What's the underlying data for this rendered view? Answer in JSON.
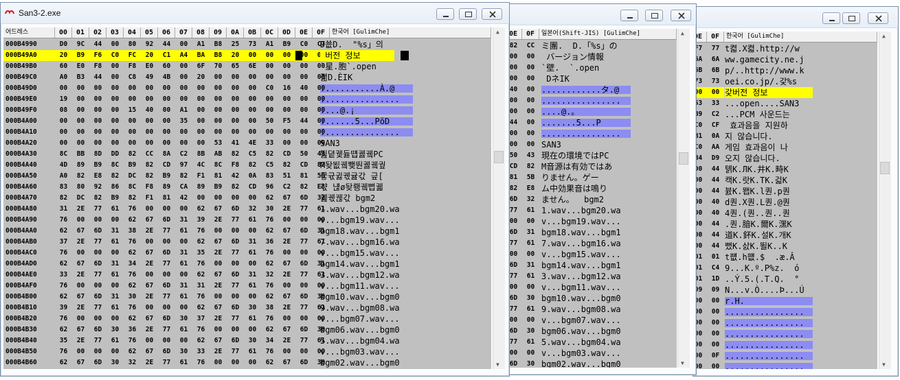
{
  "colors": {
    "highlight": "#ffff00",
    "block": "#8c8cf2",
    "pane": "#c0c0c0"
  },
  "win1": {
    "title": "San3-2.exe",
    "header_address": "어드레스",
    "header_text": "한국어 [GulimChe]",
    "columns": [
      "00",
      "01",
      "02",
      "03",
      "04",
      "05",
      "06",
      "07",
      "08",
      "09",
      "0A",
      "0B",
      "0C",
      "0D",
      "0E",
      "0F"
    ],
    "rows": [
      {
        "addr": "000B4990",
        "bytes": [
          "D0",
          "9C",
          "44",
          "00",
          "80",
          "92",
          "44",
          "00",
          "A1",
          "B8",
          "25",
          "73",
          "A1",
          "B9",
          "C0",
          "C7"
        ],
        "text": "Ð쑚D.  \"%s」의"
      },
      {
        "addr": "000B49A0",
        "bytes": [
          "20",
          "B9",
          "F6",
          "C0",
          "FC",
          "20",
          "C1",
          "A4",
          "BA",
          "B8",
          "20",
          "00",
          "00",
          "00",
          "00",
          "00"
        ],
        "text": " 버전 정보"
      },
      {
        "addr": "000B49B0",
        "bytes": [
          "60",
          "E0",
          "F8",
          "00",
          "F8",
          "E0",
          "60",
          "00",
          "6F",
          "70",
          "65",
          "6E",
          "00",
          "00",
          "00",
          "00"
        ],
        "text": "`星.胞`.open"
      },
      {
        "addr": "000B49C0",
        "bytes": [
          "A0",
          "B3",
          "44",
          "00",
          "C8",
          "49",
          "4B",
          "00",
          "20",
          "00",
          "00",
          "00",
          "00",
          "00",
          "00",
          "00"
        ],
        "text": "졂D.ÈIK"
      },
      {
        "addr": "000B49D0",
        "bytes": [
          "00",
          "00",
          "00",
          "00",
          "00",
          "00",
          "00",
          "00",
          "00",
          "00",
          "00",
          "00",
          "C0",
          "16",
          "40",
          "00"
        ],
        "text": "............À.@"
      },
      {
        "addr": "000B49E0",
        "bytes": [
          "19",
          "00",
          "00",
          "00",
          "00",
          "00",
          "00",
          "00",
          "00",
          "00",
          "00",
          "00",
          "00",
          "00",
          "00",
          "00"
        ],
        "text": "................"
      },
      {
        "addr": "000B49F0",
        "bytes": [
          "08",
          "00",
          "00",
          "00",
          "15",
          "40",
          "00",
          "A1",
          "00",
          "00",
          "00",
          "00",
          "00",
          "00",
          "00",
          "00"
        ],
        "text": "....@.¡"
      },
      {
        "addr": "000B4A00",
        "bytes": [
          "00",
          "00",
          "00",
          "00",
          "00",
          "00",
          "00",
          "35",
          "00",
          "00",
          "00",
          "00",
          "50",
          "F5",
          "44",
          "00"
        ],
        "text": ".......5...PõD"
      },
      {
        "addr": "000B4A10",
        "bytes": [
          "00",
          "00",
          "00",
          "00",
          "00",
          "00",
          "00",
          "00",
          "00",
          "00",
          "00",
          "00",
          "00",
          "00",
          "00",
          "00"
        ],
        "text": "................"
      },
      {
        "addr": "000B4A20",
        "bytes": [
          "00",
          "00",
          "00",
          "00",
          "00",
          "00",
          "00",
          "00",
          "00",
          "53",
          "41",
          "4E",
          "33",
          "00",
          "00",
          "00"
        ],
        "text": "SAN3"
      },
      {
        "addr": "000B4A30",
        "bytes": [
          "8C",
          "BB",
          "8D",
          "DD",
          "82",
          "CC",
          "8A",
          "C2",
          "8B",
          "AB",
          "82",
          "C5",
          "82",
          "CD",
          "50",
          "43"
        ],
        "text": "뙲뎥궻듏떕궳궼PC"
      },
      {
        "addr": "000B4A40",
        "bytes": [
          "4D",
          "89",
          "B9",
          "8C",
          "B9",
          "82",
          "CD",
          "97",
          "4C",
          "8C",
          "F8",
          "82",
          "C5",
          "82",
          "CD",
          "82"
        ],
        "text": "M돶뙶궼뾎뚼궳궼궢"
      },
      {
        "addr": "000B4A50",
        "bytes": [
          "A0",
          "82",
          "E8",
          "82",
          "DC",
          "82",
          "B9",
          "82",
          "F1",
          "81",
          "42",
          "0A",
          "83",
          "51",
          "81",
          "5B"
        ],
        "text": "궇귟귏궧귪갃 긒["
      },
      {
        "addr": "000B4A60",
        "bytes": [
          "83",
          "80",
          "92",
          "86",
          "8C",
          "F8",
          "89",
          "CA",
          "89",
          "B9",
          "82",
          "CD",
          "96",
          "C2",
          "82",
          "E8"
        ],
        "text": "갻 냲ø돶뢩궼뻡궯"
      },
      {
        "addr": "000B4A70",
        "bytes": [
          "82",
          "DC",
          "82",
          "B9",
          "82",
          "F1",
          "81",
          "42",
          "00",
          "00",
          "00",
          "00",
          "62",
          "67",
          "6D",
          "32"
        ],
        "text": "궲궧궪갃 bgm2"
      },
      {
        "addr": "000B4A80",
        "bytes": [
          "31",
          "2E",
          "77",
          "61",
          "76",
          "00",
          "00",
          "00",
          "62",
          "67",
          "6D",
          "32",
          "30",
          "2E",
          "77",
          "61"
        ],
        "text": "1.wav...bgm20.wa"
      },
      {
        "addr": "000B4A90",
        "bytes": [
          "76",
          "00",
          "00",
          "00",
          "62",
          "67",
          "6D",
          "31",
          "39",
          "2E",
          "77",
          "61",
          "76",
          "00",
          "00",
          "00"
        ],
        "text": "v...bgm19.wav..."
      },
      {
        "addr": "000B4AA0",
        "bytes": [
          "62",
          "67",
          "6D",
          "31",
          "38",
          "2E",
          "77",
          "61",
          "76",
          "00",
          "00",
          "00",
          "62",
          "67",
          "6D",
          "31"
        ],
        "text": "bgm18.wav...bgm1"
      },
      {
        "addr": "000B4AB0",
        "bytes": [
          "37",
          "2E",
          "77",
          "61",
          "76",
          "00",
          "00",
          "00",
          "62",
          "67",
          "6D",
          "31",
          "36",
          "2E",
          "77",
          "61"
        ],
        "text": "7.wav...bgm16.wa"
      },
      {
        "addr": "000B4AC0",
        "bytes": [
          "76",
          "00",
          "00",
          "00",
          "62",
          "67",
          "6D",
          "31",
          "35",
          "2E",
          "77",
          "61",
          "76",
          "00",
          "00",
          "00"
        ],
        "text": "v...bgm15.wav..."
      },
      {
        "addr": "000B4AD0",
        "bytes": [
          "62",
          "67",
          "6D",
          "31",
          "34",
          "2E",
          "77",
          "61",
          "76",
          "00",
          "00",
          "00",
          "62",
          "67",
          "6D",
          "31"
        ],
        "text": "bgm14.wav...bgm1"
      },
      {
        "addr": "000B4AE0",
        "bytes": [
          "33",
          "2E",
          "77",
          "61",
          "76",
          "00",
          "00",
          "00",
          "62",
          "67",
          "6D",
          "31",
          "32",
          "2E",
          "77",
          "61"
        ],
        "text": "3.wav...bgm12.wa"
      },
      {
        "addr": "000B4AF0",
        "bytes": [
          "76",
          "00",
          "00",
          "00",
          "62",
          "67",
          "6D",
          "31",
          "31",
          "2E",
          "77",
          "61",
          "76",
          "00",
          "00",
          "00"
        ],
        "text": "v...bgm11.wav..."
      },
      {
        "addr": "000B4B00",
        "bytes": [
          "62",
          "67",
          "6D",
          "31",
          "30",
          "2E",
          "77",
          "61",
          "76",
          "00",
          "00",
          "00",
          "62",
          "67",
          "6D",
          "30"
        ],
        "text": "bgm10.wav...bgm0"
      },
      {
        "addr": "000B4B10",
        "bytes": [
          "39",
          "2E",
          "77",
          "61",
          "76",
          "00",
          "00",
          "00",
          "62",
          "67",
          "6D",
          "30",
          "38",
          "2E",
          "77",
          "61"
        ],
        "text": "9.wav...bgm08.wa"
      },
      {
        "addr": "000B4B20",
        "bytes": [
          "76",
          "00",
          "00",
          "00",
          "62",
          "67",
          "6D",
          "30",
          "37",
          "2E",
          "77",
          "61",
          "76",
          "00",
          "00",
          "00"
        ],
        "text": "v...bgm07.wav..."
      },
      {
        "addr": "000B4B30",
        "bytes": [
          "62",
          "67",
          "6D",
          "30",
          "36",
          "2E",
          "77",
          "61",
          "76",
          "00",
          "00",
          "00",
          "62",
          "67",
          "6D",
          "30"
        ],
        "text": "bgm06.wav...bgm0"
      },
      {
        "addr": "000B4B40",
        "bytes": [
          "35",
          "2E",
          "77",
          "61",
          "76",
          "00",
          "00",
          "00",
          "62",
          "67",
          "6D",
          "30",
          "34",
          "2E",
          "77",
          "61"
        ],
        "text": "5.wav...bgm04.wa"
      },
      {
        "addr": "000B4B50",
        "bytes": [
          "76",
          "00",
          "00",
          "00",
          "62",
          "67",
          "6D",
          "30",
          "33",
          "2E",
          "77",
          "61",
          "76",
          "00",
          "00",
          "00"
        ],
        "text": "v...bgm03.wav..."
      },
      {
        "addr": "000B4B60",
        "bytes": [
          "62",
          "67",
          "6D",
          "30",
          "32",
          "2E",
          "77",
          "61",
          "76",
          "00",
          "00",
          "00",
          "62",
          "67",
          "6D",
          "30"
        ],
        "text": "bgm02.wav...bgm0"
      }
    ]
  },
  "win2": {
    "header_cols": [
      "0E",
      "0F"
    ],
    "header_text": "일본어(Shift-JIS) [GulimChe]",
    "rows": [
      {
        "b": [
          "82",
          "CC"
        ],
        "text": "ミ團.  D.「%s」の"
      },
      {
        "b": [
          "00",
          "00"
        ],
        "text": " バージョン情報"
      },
      {
        "b": [
          "00",
          "00"
        ],
        "text": "`壁.  `.open"
      },
      {
        "b": [
          "00",
          "00"
        ],
        "text": " DネIK"
      },
      {
        "b": [
          "40",
          "00"
        ],
        "text": "............タ.@"
      },
      {
        "b": [
          "00",
          "00"
        ],
        "text": "................"
      },
      {
        "b": [
          "00",
          "00"
        ],
        "text": "....@.｡"
      },
      {
        "b": [
          "44",
          "00"
        ],
        "text": ".......5...P"
      },
      {
        "b": [
          "00",
          "00"
        ],
        "text": "................"
      },
      {
        "b": [
          "00",
          "00"
        ],
        "text": "SAN3"
      },
      {
        "b": [
          "50",
          "43"
        ],
        "text": "現在の環境ではPC"
      },
      {
        "b": [
          "CD",
          "82"
        ],
        "text": "M音源は有効ではあ"
      },
      {
        "b": [
          "81",
          "5B"
        ],
        "text": "りません。ゲー"
      },
      {
        "b": [
          "82",
          "E8"
        ],
        "text": "ム中効果音は鳴り"
      },
      {
        "b": [
          "6D",
          "32"
        ],
        "text": "ません。  bgm2"
      },
      {
        "b": [
          "77",
          "61"
        ],
        "text": "1.wav...bgm20.wa"
      },
      {
        "b": [
          "00",
          "00"
        ],
        "text": "v...bgm19.wav..."
      },
      {
        "b": [
          "6D",
          "31"
        ],
        "text": "bgm18.wav...bgm1"
      },
      {
        "b": [
          "77",
          "61"
        ],
        "text": "7.wav...bgm16.wa"
      },
      {
        "b": [
          "00",
          "00"
        ],
        "text": "v...bgm15.wav..."
      },
      {
        "b": [
          "6D",
          "31"
        ],
        "text": "bgm14.wav...bgm1"
      },
      {
        "b": [
          "77",
          "61"
        ],
        "text": "3.wav...bgm12.wa"
      },
      {
        "b": [
          "00",
          "00"
        ],
        "text": "v...bgm11.wav..."
      },
      {
        "b": [
          "6D",
          "30"
        ],
        "text": "bgm10.wav...bgm0"
      },
      {
        "b": [
          "77",
          "61"
        ],
        "text": "9.wav...bgm08.wa"
      },
      {
        "b": [
          "00",
          "00"
        ],
        "text": "v...bgm07.wav..."
      },
      {
        "b": [
          "6D",
          "30"
        ],
        "text": "bgm06.wav...bgm0"
      },
      {
        "b": [
          "77",
          "61"
        ],
        "text": "5.wav...bgm04.wa"
      },
      {
        "b": [
          "00",
          "00"
        ],
        "text": "v...bgm03.wav..."
      },
      {
        "b": [
          "6D",
          "30"
        ],
        "text": "bgm02.wav...bgm0"
      }
    ]
  },
  "win3": {
    "header_cols": [
      "0E",
      "0F"
    ],
    "header_text": "한국어 [GulimChe]",
    "rows": [
      {
        "b": [
          "F7",
          "77"
        ],
        "text": "t켧.X켧.http://w"
      },
      {
        "b": [
          "6A",
          "6A"
        ],
        "text": "ww.gamecity.ne.j"
      },
      {
        "b": [
          "6B",
          "6B"
        ],
        "text": "p/..http://www.k"
      },
      {
        "b": [
          "73",
          "73"
        ],
        "text": "oei.co.jp/.갗%s"
      },
      {
        "b": [
          "00",
          "00"
        ],
        "text": "갗버전 정보"
      },
      {
        "b": [
          "53",
          "33"
        ],
        "text": "...open....SAN3"
      },
      {
        "b": [
          "B9",
          "C2"
        ],
        "text": "...PCM 사운드는"
      },
      {
        "b": [
          "C0",
          "CF"
        ],
        "text": " 효과음을 지원하"
      },
      {
        "b": [
          "B1",
          "0A"
        ],
        "text": "지 않습니다."
      },
      {
        "b": [
          "C0",
          "AA"
        ],
        "text": "게임 효과음이 나"
      },
      {
        "b": [
          "B4",
          "D9"
        ],
        "text": "오지 않습니다."
      },
      {
        "b": [
          "00",
          "44"
        ],
        "text": "톍K.ЛK.井K.畤K"
      },
      {
        "b": [
          "00",
          "44"
        ],
        "text": "캑K.랏K.TK.걻K"
      },
      {
        "b": [
          "00",
          "44"
        ],
        "text": "뷼K.뫱K.l퀀.p퀀"
      },
      {
        "b": [
          "00",
          "40"
        ],
        "text": "d퀀.X퀀.L퀀.@퀀"
      },
      {
        "b": [
          "00",
          "40"
        ],
        "text": "4퀀.(퀀..퀀..퀀"
      },
      {
        "b": [
          "00",
          "44"
        ],
        "text": ".퀀.腤K.爾K.潶K"
      },
      {
        "b": [
          "00",
          "44"
        ],
        "text": "道K.鈈K.설K.개K"
      },
      {
        "b": [
          "00",
          "44"
        ],
        "text": "뻤K.삸K.뙬K..K"
      },
      {
        "b": [
          "01",
          "01"
        ],
        "text": "t퍲.h퍲.$  .æ.Â"
      },
      {
        "b": [
          "01",
          "C4"
        ],
        "text": "9...K.º.P%z.  ó"
      },
      {
        "b": [
          "01",
          "1D"
        ],
        "text": "..Ý.5.(.T.Q.  °"
      },
      {
        "b": [
          "09",
          "09"
        ],
        "text": "N...v.Ò....Þ...Ú"
      },
      {
        "b": [
          "00",
          "00"
        ],
        "text": "r.H."
      },
      {
        "b": [
          "00",
          "00"
        ],
        "text": "................"
      },
      {
        "b": [
          "00",
          "00"
        ],
        "text": "................"
      },
      {
        "b": [
          "00",
          "00"
        ],
        "text": "................"
      },
      {
        "b": [
          "00",
          "00"
        ],
        "text": "................"
      },
      {
        "b": [
          "00",
          "0F"
        ],
        "text": "................"
      },
      {
        "b": [
          "00",
          "00"
        ],
        "text": "................"
      }
    ]
  }
}
